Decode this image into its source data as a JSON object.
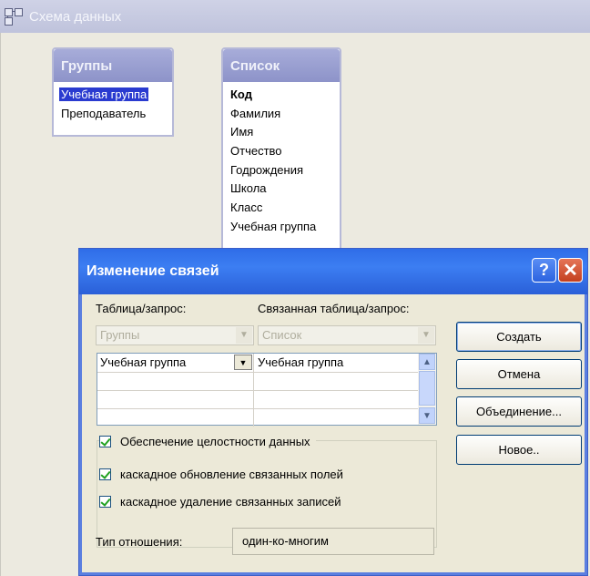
{
  "window": {
    "title": "Схема данных"
  },
  "tables": [
    {
      "name": "Группы",
      "fields": [
        "Учебная группа",
        "Преподаватель"
      ]
    },
    {
      "name": "Список",
      "fields": [
        "Код",
        "Фамилия",
        "Имя",
        "Отчество",
        "Годрождения",
        "Школа",
        "Класс",
        "Учебная группа"
      ]
    }
  ],
  "dialog": {
    "title": "Изменение связей",
    "help_label": "?",
    "close_label": "✕",
    "table_label": "Таблица/запрос:",
    "related_label": "Связанная таблица/запрос:",
    "table_value": "Группы",
    "related_value": "Список",
    "fields_row": {
      "left": "Учебная группа",
      "right": "Учебная группа"
    },
    "buttons": {
      "create": "Создать",
      "cancel": "Отмена",
      "join": "Объединение...",
      "new": "Новое.."
    },
    "checkboxes": {
      "integrity": "Обеспечение целостности данных",
      "cascade_update": "каскадное обновление связанных полей",
      "cascade_delete": "каскадное удаление связанных записей"
    },
    "relation_type_label": "Тип отношения:",
    "relation_type_value": "один-ко-многим"
  }
}
